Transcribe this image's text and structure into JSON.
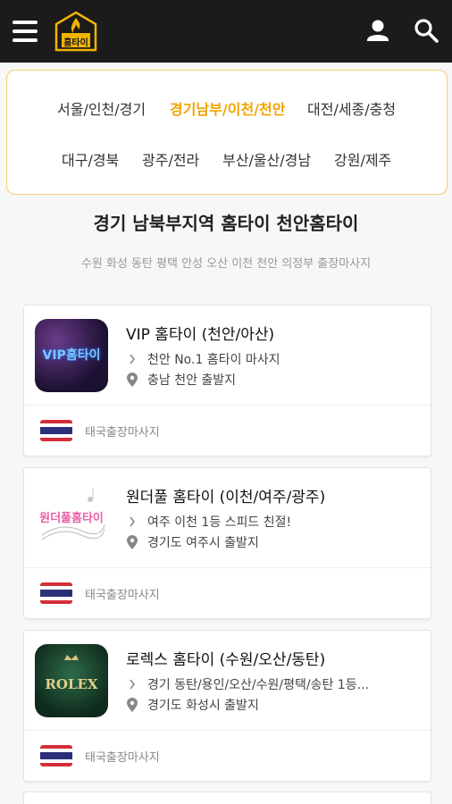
{
  "header": {
    "logo_icon": "flame-logo-icon",
    "logo_text": "홈타이"
  },
  "regions": [
    {
      "label": "서울/인천/경기",
      "active": false
    },
    {
      "label": "경기남부/이천/천안",
      "active": true
    },
    {
      "label": "대전/세종/충청",
      "active": false
    },
    {
      "label": "대구/경북",
      "active": false
    },
    {
      "label": "광주/전라",
      "active": false
    },
    {
      "label": "부산/울산/경남",
      "active": false
    },
    {
      "label": "강원/제주",
      "active": false
    }
  ],
  "section": {
    "title": "경기 남북부지역 홈타이 천안홈타이",
    "subtitle": "수원 화성 동탄 평택 안성 오산 이천 천안 의정부 출장마사지"
  },
  "listings": [
    {
      "name": "VIP 홈타이 (천안/아산)",
      "desc": "천안 No.1 홈타이 마사지",
      "location": "충남 천안 출발지",
      "tag": "태국출장마사지",
      "thumb_text": "VIP홈타이"
    },
    {
      "name": "원더풀 홈타이 (이천/여주/광주)",
      "desc": "여주 이천 1등 스피드 친절!",
      "location": "경기도 여주시 출발지",
      "tag": "태국출장마사지",
      "thumb_text": "원더풀홈타이"
    },
    {
      "name": "로렉스 홈타이 (수원/오산/동탄)",
      "desc": "경기 동탄/용인/오산/수원/평택/송탄 1등...",
      "location": "경기도 화성시 출발지",
      "tag": "태국출장마사지",
      "thumb_text": "ROLEX"
    }
  ],
  "colors": {
    "accent": "#f0a500",
    "appbar": "#1b1b1b",
    "region_border": "#f1cf6e"
  }
}
